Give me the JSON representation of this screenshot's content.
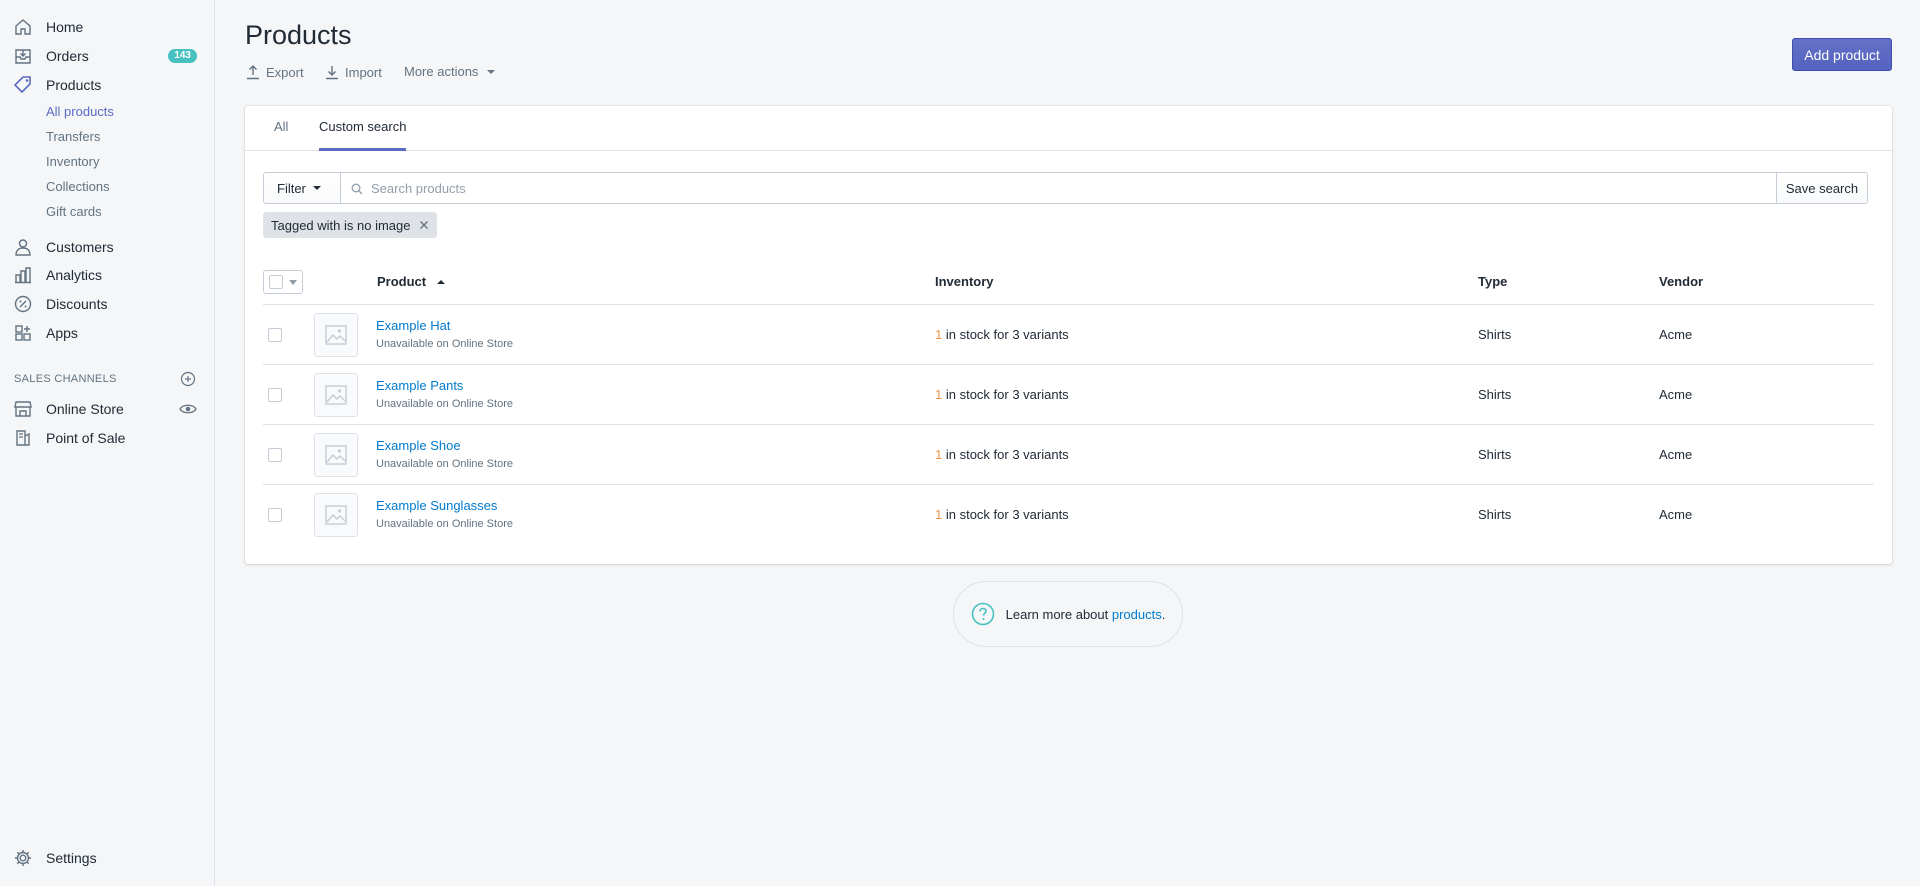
{
  "sidebar": {
    "items": [
      {
        "label": "Home",
        "icon": "home-icon"
      },
      {
        "label": "Orders",
        "icon": "orders-icon",
        "badge": "143"
      },
      {
        "label": "Products",
        "icon": "tag-icon"
      },
      {
        "label": "Customers",
        "icon": "person-icon"
      },
      {
        "label": "Analytics",
        "icon": "bar-chart-icon"
      },
      {
        "label": "Discounts",
        "icon": "discount-icon"
      },
      {
        "label": "Apps",
        "icon": "apps-icon"
      }
    ],
    "product_subitems": [
      "All products",
      "Transfers",
      "Inventory",
      "Collections",
      "Gift cards"
    ],
    "sales_channels_heading": "SALES CHANNELS",
    "channels": [
      {
        "label": "Online Store",
        "icon": "store-icon"
      },
      {
        "label": "Point of Sale",
        "icon": "pos-icon"
      }
    ],
    "settings": "Settings"
  },
  "header": {
    "title": "Products",
    "export": "Export",
    "import": "Import",
    "more_actions": "More actions",
    "add_product": "Add product"
  },
  "tabs": [
    "All",
    "Custom search"
  ],
  "filter": {
    "filter_label": "Filter",
    "search_placeholder": "Search products",
    "save_search": "Save search",
    "applied_tag": "Tagged with is no image"
  },
  "table": {
    "headers": {
      "product": "Product",
      "inventory": "Inventory",
      "type": "Type",
      "vendor": "Vendor"
    },
    "rows": [
      {
        "name": "Example Hat",
        "status": "Unavailable on Online Store",
        "stock": "1",
        "stock_text": "in stock for 3 variants",
        "type": "Shirts",
        "vendor": "Acme"
      },
      {
        "name": "Example Pants",
        "status": "Unavailable on Online Store",
        "stock": "1",
        "stock_text": "in stock for 3 variants",
        "type": "Shirts",
        "vendor": "Acme"
      },
      {
        "name": "Example Shoe",
        "status": "Unavailable on Online Store",
        "stock": "1",
        "stock_text": "in stock for 3 variants",
        "type": "Shirts",
        "vendor": "Acme"
      },
      {
        "name": "Example Sunglasses",
        "status": "Unavailable on Online Store",
        "stock": "1",
        "stock_text": "in stock for 3 variants",
        "type": "Shirts",
        "vendor": "Acme"
      }
    ]
  },
  "help": {
    "text": "Learn more about ",
    "link": "products",
    "suffix": "."
  },
  "colors": {
    "accent": "#5c6ac4",
    "link": "#007ace",
    "badge": "#47c1bf",
    "warning": "#f49342"
  }
}
